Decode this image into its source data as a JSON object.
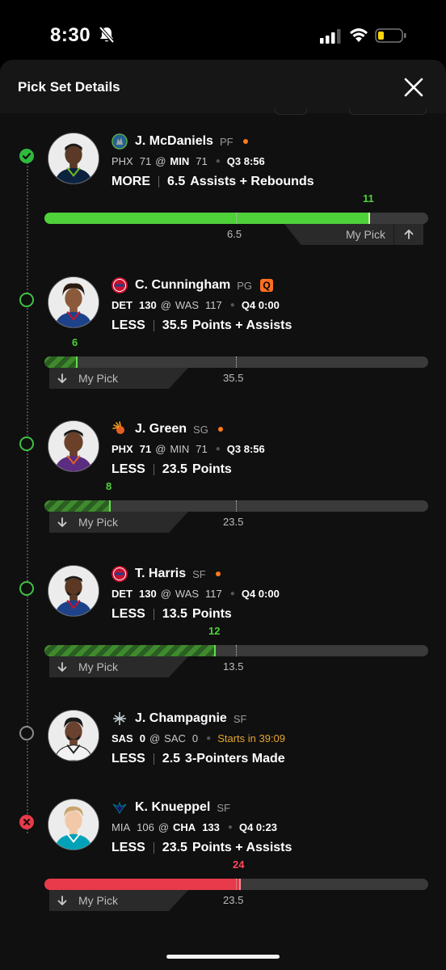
{
  "status_bar": {
    "time": "8:30"
  },
  "header": {
    "title": "Pick Set Details"
  },
  "picks": [
    {
      "status": "hit",
      "name": "J. McDaniels",
      "position": "PF",
      "away_team": "PHX",
      "away_score": "71",
      "home_team": "MIN",
      "home_score": "71",
      "bold_team": "home",
      "game_clock": "Q3 8:56",
      "direction": "MORE",
      "line": "6.5",
      "stat": "Assists + Rebounds",
      "actual": "11",
      "progress": 0.85,
      "color": "#4fd13a",
      "my_pick_label": "My Pick"
    },
    {
      "status": "open",
      "name": "C. Cunningham",
      "position": "PG",
      "badge": "Q",
      "away_team": "DET",
      "away_score": "130",
      "home_team": "WAS",
      "home_score": "117",
      "bold_team": "away",
      "game_clock": "Q4 0:00",
      "direction": "LESS",
      "line": "35.5",
      "stat": "Points + Assists",
      "actual": "6",
      "progress": 0.085,
      "color": "#4fd13a",
      "my_pick_label": "My Pick"
    },
    {
      "status": "open",
      "name": "J. Green",
      "position": "SG",
      "away_team": "PHX",
      "away_score": "71",
      "home_team": "MIN",
      "home_score": "71",
      "bold_team": "away",
      "game_clock": "Q3 8:56",
      "direction": "LESS",
      "line": "23.5",
      "stat": "Points",
      "actual": "8",
      "progress": 0.17,
      "color": "#4fd13a",
      "my_pick_label": "My Pick"
    },
    {
      "status": "open",
      "name": "T. Harris",
      "position": "SF",
      "away_team": "DET",
      "away_score": "130",
      "home_team": "WAS",
      "home_score": "117",
      "bold_team": "away",
      "game_clock": "Q4 0:00",
      "direction": "LESS",
      "line": "13.5",
      "stat": "Points",
      "actual": "12",
      "progress": 0.445,
      "color": "#4fd13a",
      "my_pick_label": "My Pick"
    },
    {
      "status": "pending",
      "name": "J. Champagnie",
      "position": "SF",
      "away_team": "SAS",
      "away_score": "0",
      "home_team": "SAC",
      "home_score": "0",
      "bold_team": "away",
      "starts_in": "Starts in 39:09",
      "direction": "LESS",
      "line": "2.5",
      "stat": "3-Pointers Made"
    },
    {
      "status": "miss",
      "name": "K. Knueppel",
      "position": "SF",
      "away_team": "MIA",
      "away_score": "106",
      "home_team": "CHA",
      "home_score": "133",
      "bold_team": "home",
      "game_clock": "Q4 0:23",
      "direction": "LESS",
      "line": "23.5",
      "stat": "Points + Assists",
      "actual": "24",
      "progress": 0.51,
      "color": "#e83a4a",
      "my_pick_label": "My Pick"
    }
  ]
}
